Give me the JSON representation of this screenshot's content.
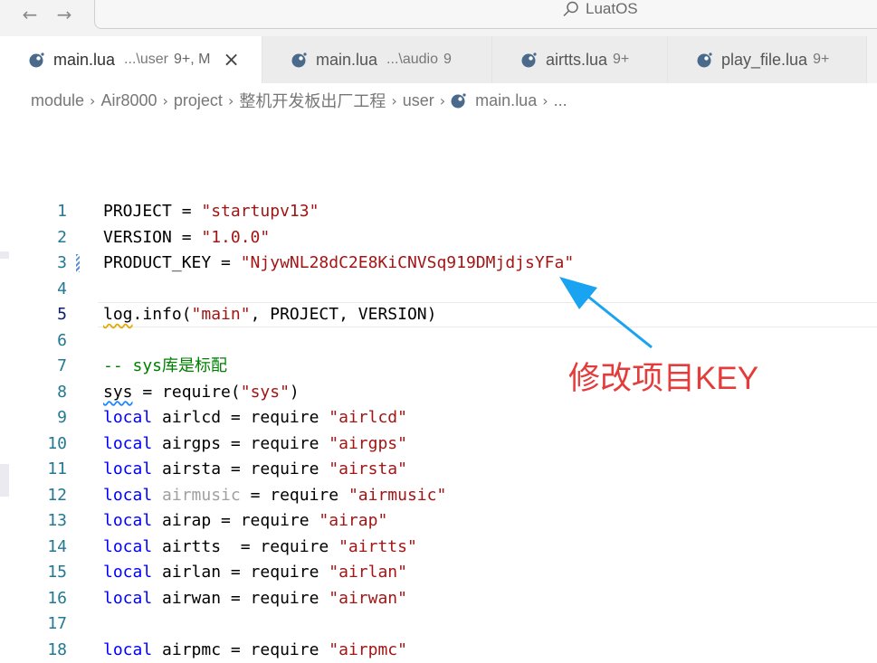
{
  "window": {
    "title": "LuatOS",
    "back_icon": "arrow-left-icon",
    "forward_icon": "arrow-right-icon",
    "search_icon": "search-icon"
  },
  "tabs": [
    {
      "name": "main.lua",
      "path": "...\\user",
      "badge": "9+, M",
      "active": true,
      "close": "×"
    },
    {
      "name": "main.lua",
      "path": "...\\audio",
      "badge": "9",
      "active": false
    },
    {
      "name": "airtts.lua",
      "path": "",
      "badge": "9+",
      "active": false
    },
    {
      "name": "play_file.lua",
      "path": "",
      "badge": "9+",
      "active": false
    }
  ],
  "breadcrumb": [
    "module",
    "Air8000",
    "project",
    "整机开发板出厂工程",
    "user",
    "main.lua",
    "..."
  ],
  "code_lines": [
    {
      "n": "1",
      "parts": [
        [
          "",
          "PROJECT = "
        ],
        [
          "str",
          "\"startupv13\""
        ]
      ]
    },
    {
      "n": "2",
      "parts": [
        [
          "",
          "VERSION = "
        ],
        [
          "str",
          "\"1.0.0\""
        ]
      ]
    },
    {
      "n": "3",
      "parts": [
        [
          "",
          "PRODUCT_KEY = "
        ],
        [
          "str",
          "\"NjywNL28dC2E8KiCNVSq919DMjdjsYFa\""
        ]
      ]
    },
    {
      "n": "4",
      "parts": []
    },
    {
      "n": "5",
      "parts": [
        [
          "squig",
          "log"
        ],
        [
          "",
          ".info("
        ],
        [
          "str",
          "\"main\""
        ],
        [
          "",
          ", PROJECT, VERSION)"
        ]
      ]
    },
    {
      "n": "6",
      "parts": []
    },
    {
      "n": "7",
      "parts": [
        [
          "cmt",
          "-- sys库是标配"
        ]
      ]
    },
    {
      "n": "8",
      "parts": [
        [
          "squig-blue",
          "sys"
        ],
        [
          "",
          " = require("
        ],
        [
          "str",
          "\"sys\""
        ],
        [
          "",
          ")"
        ]
      ]
    },
    {
      "n": "9",
      "parts": [
        [
          "kw",
          "local"
        ],
        [
          "",
          " airlcd = require "
        ],
        [
          "str",
          "\"airlcd\""
        ]
      ]
    },
    {
      "n": "10",
      "parts": [
        [
          "kw",
          "local"
        ],
        [
          "",
          " airgps = require "
        ],
        [
          "str",
          "\"airgps\""
        ]
      ]
    },
    {
      "n": "11",
      "parts": [
        [
          "kw",
          "local"
        ],
        [
          "",
          " airsta = require "
        ],
        [
          "str",
          "\"airsta\""
        ]
      ]
    },
    {
      "n": "12",
      "parts": [
        [
          "kw",
          "local"
        ],
        [
          "",
          " "
        ],
        [
          "dim",
          "airmusic"
        ],
        [
          "",
          " = require "
        ],
        [
          "str",
          "\"airmusic\""
        ]
      ]
    },
    {
      "n": "13",
      "parts": [
        [
          "kw",
          "local"
        ],
        [
          "",
          " airap = require "
        ],
        [
          "str",
          "\"airap\""
        ]
      ]
    },
    {
      "n": "14",
      "parts": [
        [
          "kw",
          "local"
        ],
        [
          "",
          " airtts  = require "
        ],
        [
          "str",
          "\"airtts\""
        ]
      ]
    },
    {
      "n": "15",
      "parts": [
        [
          "kw",
          "local"
        ],
        [
          "",
          " airlan = require "
        ],
        [
          "str",
          "\"airlan\""
        ]
      ]
    },
    {
      "n": "16",
      "parts": [
        [
          "kw",
          "local"
        ],
        [
          "",
          " airwan = require "
        ],
        [
          "str",
          "\"airwan\""
        ]
      ]
    },
    {
      "n": "17",
      "parts": []
    },
    {
      "n": "18",
      "parts": [
        [
          "kw",
          "local"
        ],
        [
          "",
          " airpmc = require "
        ],
        [
          "str",
          "\"airpmc\""
        ]
      ]
    }
  ],
  "current_line": "5",
  "annotation": {
    "text": "修改项目KEY",
    "color": "#e43b3b",
    "arrow_color": "#1aa3f0"
  },
  "colors": {
    "keyword": "#0000ff",
    "string": "#a31515",
    "comment": "#008000",
    "line_number": "#237893"
  }
}
